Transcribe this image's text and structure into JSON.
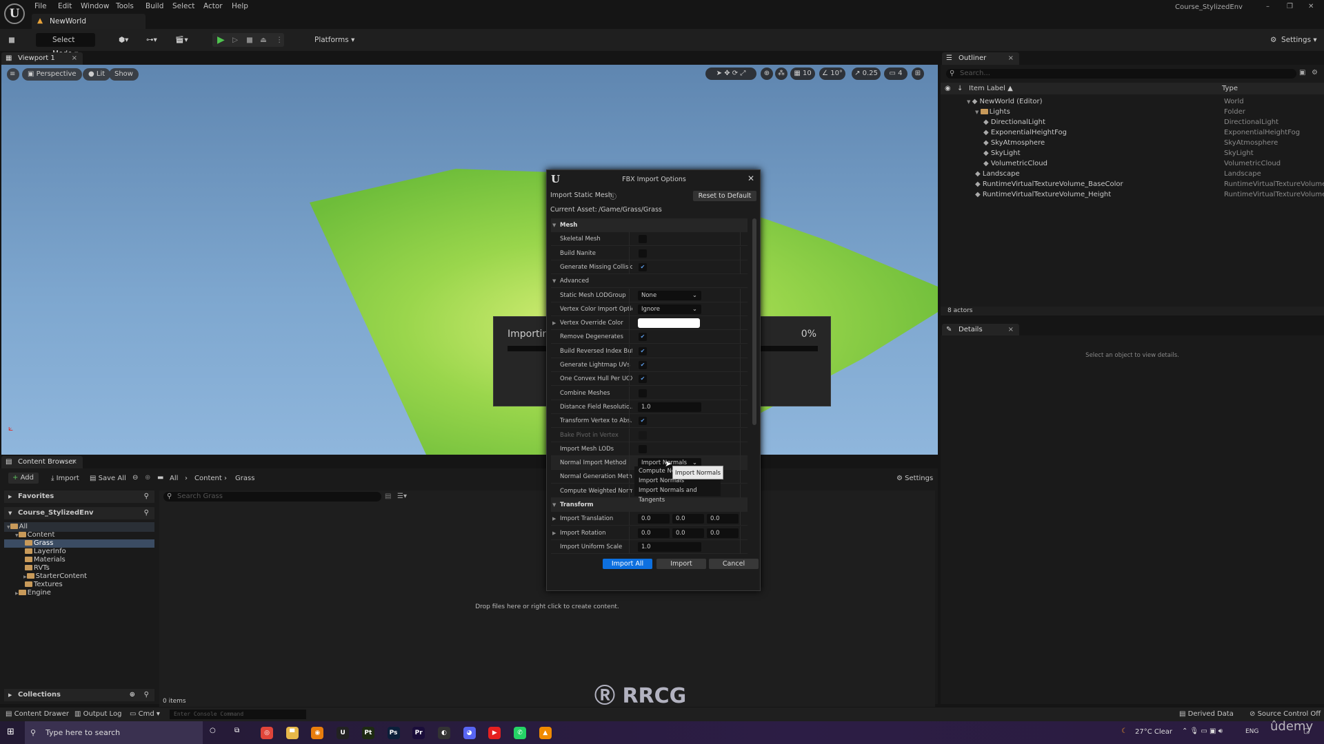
{
  "app": {
    "menu": [
      "File",
      "Edit",
      "Window",
      "Tools",
      "Build",
      "Select",
      "Actor",
      "Help"
    ],
    "world_tab": "NewWorld",
    "project": "Course_StylizedEnv"
  },
  "toolbar": {
    "select_mode": "Select Mode",
    "platforms": "Platforms",
    "settings": "Settings"
  },
  "viewport": {
    "tab": "Viewport 1",
    "perspective": "Perspective",
    "lit": "Lit",
    "show": "Show",
    "grid": "10",
    "angle": "10°",
    "scale": "0.25",
    "camera": "4"
  },
  "outliner": {
    "tab": "Outliner",
    "search_placeholder": "Search...",
    "col_label": "Item Label ▲",
    "col_type": "Type",
    "count": "8 actors",
    "rows": [
      {
        "label": "NewWorld (Editor)",
        "type": "World",
        "indent": 1
      },
      {
        "label": "Lights",
        "type": "Folder",
        "indent": 2
      },
      {
        "label": "DirectionalLight",
        "type": "DirectionalLight",
        "indent": 3
      },
      {
        "label": "ExponentialHeightFog",
        "type": "ExponentialHeightFog",
        "indent": 3
      },
      {
        "label": "SkyAtmosphere",
        "type": "SkyAtmosphere",
        "indent": 3
      },
      {
        "label": "SkyLight",
        "type": "SkyLight",
        "indent": 3
      },
      {
        "label": "VolumetricCloud",
        "type": "VolumetricCloud",
        "indent": 3
      },
      {
        "label": "Landscape",
        "type": "Landscape",
        "indent": 2
      },
      {
        "label": "RuntimeVirtualTextureVolume_BaseColor",
        "type": "RuntimeVirtualTextureVolume",
        "indent": 2
      },
      {
        "label": "RuntimeVirtualTextureVolume_Height",
        "type": "RuntimeVirtualTextureVolume",
        "indent": 2
      }
    ]
  },
  "details": {
    "tab": "Details",
    "empty": "Select an object to view details."
  },
  "content_browser": {
    "tab": "Content Browser",
    "add": "Add",
    "import": "Import",
    "save_all": "Save All",
    "breadcrumb": [
      "All",
      "Content",
      "Grass"
    ],
    "settings": "Settings",
    "favorites": "Favorites",
    "project": "Course_StylizedEnv",
    "search_placeholder": "Search Grass",
    "drop_hint": "Drop files here or right click to create content.",
    "collections": "Collections",
    "items": "0 items",
    "tree": [
      {
        "label": "All",
        "indent": 0
      },
      {
        "label": "Content",
        "indent": 1
      },
      {
        "label": "Grass",
        "indent": 2,
        "selected": true
      },
      {
        "label": "LayerInfo",
        "indent": 2
      },
      {
        "label": "Materials",
        "indent": 2
      },
      {
        "label": "RVTs",
        "indent": 2
      },
      {
        "label": "StarterContent",
        "indent": 2
      },
      {
        "label": "Textures",
        "indent": 2
      },
      {
        "label": "Engine",
        "indent": 1
      }
    ]
  },
  "statusbar": {
    "content_drawer": "Content Drawer",
    "output_log": "Output Log",
    "cmd": "Cmd",
    "console_placeholder": "Enter Console Command",
    "derived_data": "Derived Data",
    "source_control": "Source Control Off"
  },
  "progress": {
    "label": "Importing",
    "percent": "0%",
    "value": 0
  },
  "dialog": {
    "title": "FBX Import Options",
    "subtitle": "Import Static Mesh",
    "reset": "Reset to Default",
    "current_asset_label": "Current Asset:",
    "current_asset": "/Game/Grass/Grass",
    "rows": [
      {
        "kind": "cat",
        "label": "Mesh"
      },
      {
        "kind": "check",
        "label": "Skeletal Mesh",
        "checked": false
      },
      {
        "kind": "check",
        "label": "Build Nanite",
        "checked": false
      },
      {
        "kind": "check",
        "label": "Generate Missing Collision",
        "checked": true
      },
      {
        "kind": "sub",
        "label": "Advanced"
      },
      {
        "kind": "select",
        "label": "Static Mesh LODGroup",
        "value": "None"
      },
      {
        "kind": "select",
        "label": "Vertex Color Import Option",
        "value": "Ignore"
      },
      {
        "kind": "color",
        "label": "Vertex Override Color",
        "color": "#ffffff"
      },
      {
        "kind": "check",
        "label": "Remove Degenerates",
        "checked": true
      },
      {
        "kind": "check",
        "label": "Build Reversed Index Buf...",
        "checked": true
      },
      {
        "kind": "check",
        "label": "Generate Lightmap UVs",
        "checked": true
      },
      {
        "kind": "check",
        "label": "One Convex Hull Per UCX",
        "checked": true
      },
      {
        "kind": "check",
        "label": "Combine Meshes",
        "checked": false
      },
      {
        "kind": "num",
        "label": "Distance Field Resolutio...",
        "values": [
          "1.0"
        ]
      },
      {
        "kind": "check",
        "label": "Transform Vertex to Abs...",
        "checked": true
      },
      {
        "kind": "check",
        "label": "Bake Pivot in Vertex",
        "checked": false,
        "disabled": true
      },
      {
        "kind": "check",
        "label": "Import Mesh LODs",
        "checked": false
      },
      {
        "kind": "select",
        "label": "Normal Import Method",
        "value": "Import Normals"
      },
      {
        "kind": "none",
        "label": "Normal Generation Meth..."
      },
      {
        "kind": "none",
        "label": "Compute Weighted Norm..."
      },
      {
        "kind": "cat",
        "label": "Transform"
      },
      {
        "kind": "vec",
        "label": "Import Translation",
        "values": [
          "0.0",
          "0.0",
          "0.0"
        ]
      },
      {
        "kind": "vec",
        "label": "Import Rotation",
        "values": [
          "0.0",
          "0.0",
          "0.0"
        ]
      },
      {
        "kind": "num",
        "label": "Import Uniform Scale",
        "values": [
          "1.0"
        ]
      }
    ],
    "dropdown_options": [
      "Compute Normals",
      "Import Normals",
      "Import Normals and Tangents"
    ],
    "tooltip": "Import Normals",
    "import_all": "Import All",
    "import": "Import",
    "cancel": "Cancel"
  },
  "taskbar": {
    "search_placeholder": "Type here to search",
    "weather": "27°C  Clear",
    "lang": "ENG",
    "apps": [
      {
        "name": "chrome",
        "color": "#e0453a",
        "t": "◎"
      },
      {
        "name": "explorer",
        "color": "#e7b84a",
        "t": "▀"
      },
      {
        "name": "blender",
        "color": "#e87d0d",
        "t": "◉"
      },
      {
        "name": "unreal",
        "color": "#222",
        "t": "U"
      },
      {
        "name": "painter",
        "color": "#1d2a12",
        "t": "Pt"
      },
      {
        "name": "photoshop",
        "color": "#0b1f3a",
        "t": "Ps"
      },
      {
        "name": "premiere",
        "color": "#1a0d3a",
        "t": "Pr"
      },
      {
        "name": "davinci",
        "color": "#333",
        "t": "◐"
      },
      {
        "name": "discord",
        "color": "#5865f2",
        "t": "◕"
      },
      {
        "name": "youtube-music",
        "color": "#e52020",
        "t": "▶"
      },
      {
        "name": "whatsapp",
        "color": "#25d366",
        "t": "✆"
      },
      {
        "name": "vlc",
        "color": "#f08a00",
        "t": "▲"
      }
    ]
  },
  "colors": {
    "accent": "#0d70e0",
    "landscape": "#8fd24a",
    "sky": "#7ea7cf"
  }
}
